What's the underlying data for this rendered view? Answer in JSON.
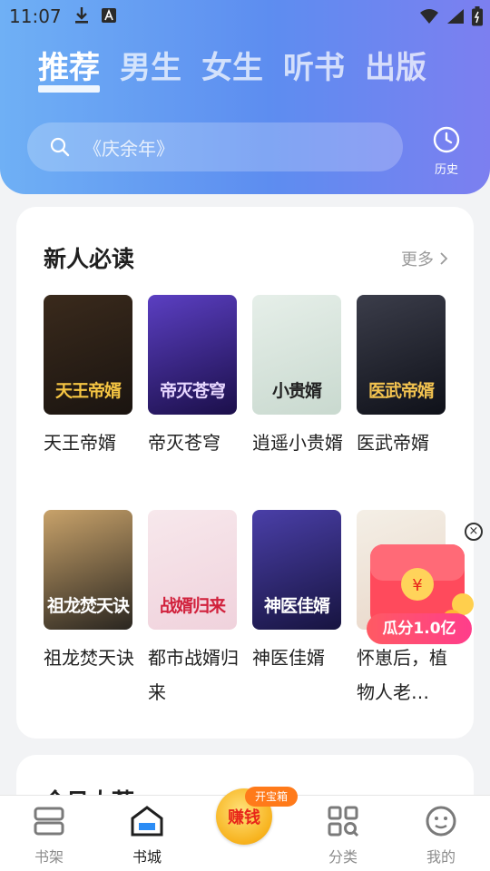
{
  "status_bar": {
    "time": "11:07",
    "icons": [
      "download-icon",
      "text-a-icon",
      "wifi-icon",
      "signal-icon",
      "battery-icon"
    ]
  },
  "top_tabs": [
    {
      "label": "推荐",
      "active": true
    },
    {
      "label": "男生",
      "active": false
    },
    {
      "label": "女生",
      "active": false
    },
    {
      "label": "听书",
      "active": false
    },
    {
      "label": "出版",
      "active": false
    }
  ],
  "search": {
    "placeholder": "《庆余年》",
    "icon": "search-icon"
  },
  "history": {
    "label": "历史",
    "icon": "clock-icon"
  },
  "section_new_reader": {
    "title": "新人必读",
    "more_label": "更多",
    "books": [
      {
        "name": "天王帝婿",
        "cover_title": "天王帝婿",
        "cover_colors": [
          "#3a2a1c",
          "#1a1410"
        ],
        "title_color": "#f5c543"
      },
      {
        "name": "帝灭苍穹",
        "cover_title": "帝灭苍穹",
        "cover_colors": [
          "#5b3fc2",
          "#1b0f4a"
        ],
        "title_color": "#e7d7ff"
      },
      {
        "name": "逍遥小贵婿",
        "cover_title": "小贵婿",
        "cover_colors": [
          "#e6efe9",
          "#c9d9cf"
        ],
        "title_color": "#222222"
      },
      {
        "name": "医武帝婿",
        "cover_title": "医武帝婿",
        "cover_colors": [
          "#3b3d4a",
          "#0f1119"
        ],
        "title_color": "#f3c350"
      },
      {
        "name": "祖龙焚天诀",
        "cover_title": "祖龙焚天诀",
        "cover_colors": [
          "#c8a26a",
          "#2a2620"
        ],
        "title_color": "#ffffff"
      },
      {
        "name": "都市战婿归来",
        "cover_title": "战婿归来",
        "cover_colors": [
          "#f7e8ec",
          "#f0d2dc"
        ],
        "title_color": "#d1213c"
      },
      {
        "name": "神医佳婿",
        "cover_title": "神医佳婿",
        "cover_colors": [
          "#4a3fa8",
          "#171440"
        ],
        "title_color": "#ffffff"
      },
      {
        "name": "怀崽后，植物人老…",
        "cover_title": "",
        "cover_colors": [
          "#f4efe6",
          "#e9d7c9"
        ],
        "title_color": "#8a6e5a"
      }
    ]
  },
  "section_second": {
    "title": "今日大荐"
  },
  "promo": {
    "label": "瓜分1.0亿",
    "close_symbol": "×"
  },
  "bottom_nav": [
    {
      "label": "书架",
      "icon": "bookshelf-icon",
      "active": false
    },
    {
      "label": "书城",
      "icon": "bookstore-home-icon",
      "active": true
    },
    {
      "label": "赚钱",
      "badge": "开宝箱",
      "icon": "earn-coin-icon",
      "active": false
    },
    {
      "label": "分类",
      "icon": "category-grid-icon",
      "active": false
    },
    {
      "label": "我的",
      "icon": "profile-face-icon",
      "active": false
    }
  ],
  "colors": {
    "accent": "#5d8df0",
    "promo_red": "#ff3d5a",
    "earn_gold": "#f7b21d"
  }
}
